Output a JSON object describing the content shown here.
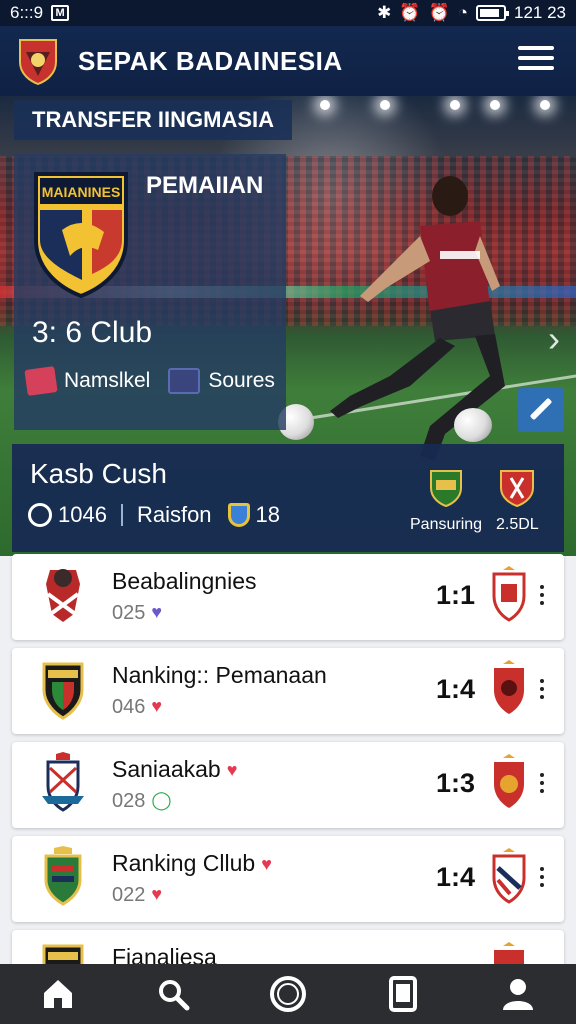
{
  "status_bar": {
    "time_left": "6:::9",
    "time_right": "121 23"
  },
  "app_bar": {
    "title": "SEPAK BADAINESIA"
  },
  "hero": {
    "label": "TRANSFER IINGMASIA",
    "club_card": {
      "crest_text": "MAIANINES",
      "title": "PEMAIIAN",
      "club_name": "3: 6 Club",
      "meta_left": "Namslkel",
      "meta_right": "Soures"
    },
    "match_card": {
      "title": "Kasb Cush",
      "stat_1": "1046",
      "stat_2": "Raisfon",
      "stat_3": "18",
      "side_left_label": "Pansuring",
      "side_right_label": "2.5DL"
    }
  },
  "list": {
    "rows": [
      {
        "name": "Beabalingnies",
        "sub": "025",
        "score": "1:1",
        "heart": "♥",
        "heart_color": "#6a5acd"
      },
      {
        "name": "Nanking:: Pemanaan",
        "sub": "046",
        "score": "1:4",
        "heart": "♥",
        "heart_color": "#e53950"
      },
      {
        "name": "Saniaakab",
        "sub": "028",
        "score": "1:3",
        "heart": "◯",
        "heart_color": "#2aa84a"
      },
      {
        "name": "Ranking Cllub",
        "sub": "022",
        "score": "1:4",
        "heart": "♥",
        "heart_color": "#e53950"
      },
      {
        "name": "Fianaliesa",
        "sub": "",
        "score": "",
        "heart": "",
        "heart_color": "#e53950"
      }
    ]
  },
  "bottom_nav": [
    "home-icon",
    "search-icon",
    "circle-icon",
    "tablet-icon",
    "profile-icon"
  ],
  "colors": {
    "primary": "#13284f",
    "card": "#172a52",
    "accent": "#2f6fb4"
  }
}
